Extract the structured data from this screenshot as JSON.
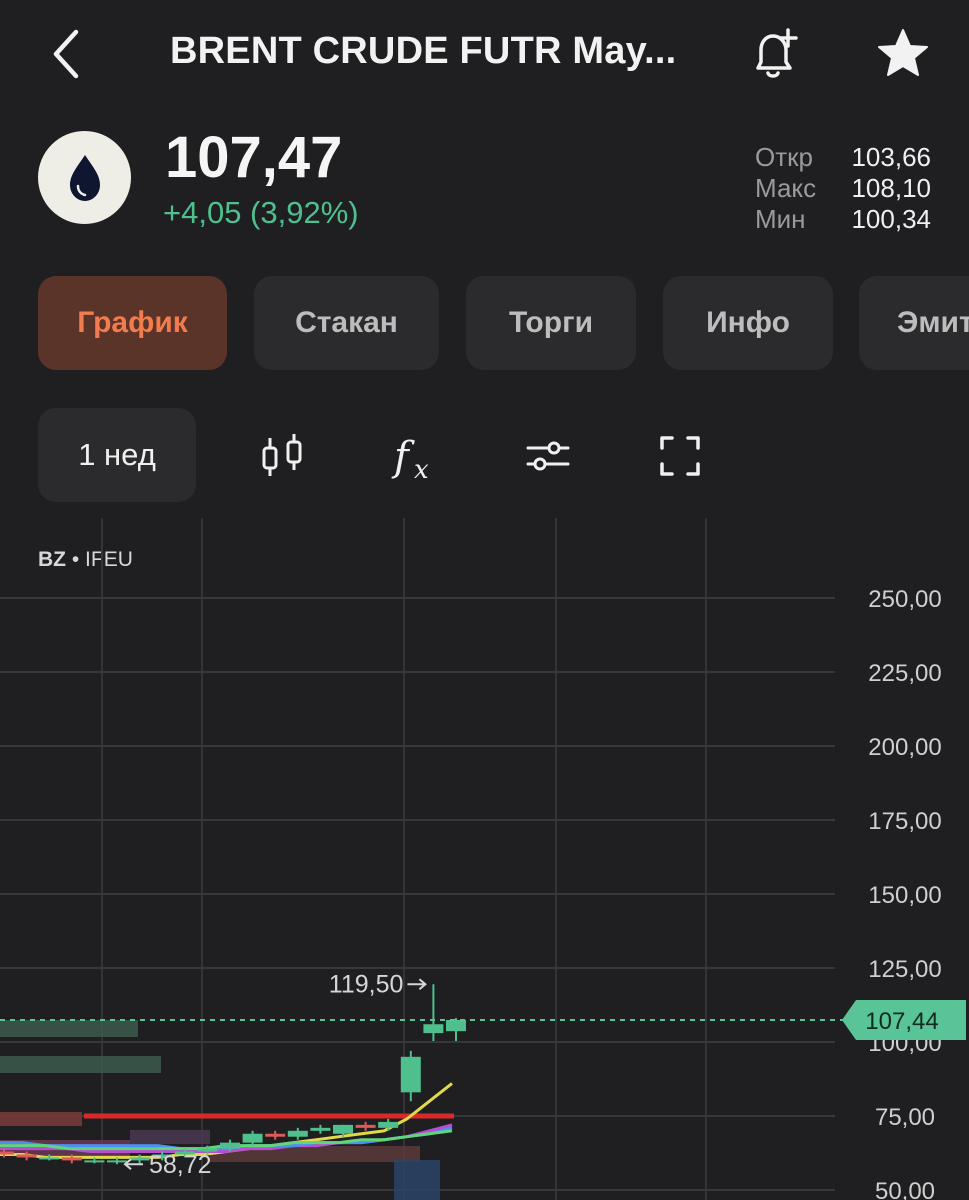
{
  "header": {
    "title": "BRENT CRUDE FUTR  May...",
    "back_icon": "chevron-left-icon",
    "alert_icon": "bell-plus-icon",
    "favorite_icon": "star-icon"
  },
  "instrument": {
    "logo_icon": "oil-drop-icon",
    "price": "107,47",
    "change": "+4,05 (3,92%)",
    "change_color": "#4fc08d",
    "stats": [
      {
        "label": "Откр",
        "value": "103,66"
      },
      {
        "label": "Макс",
        "value": "108,10"
      },
      {
        "label": "Мин",
        "value": "100,34"
      }
    ]
  },
  "tabs": [
    {
      "label": "График",
      "active": true
    },
    {
      "label": "Стакан",
      "active": false
    },
    {
      "label": "Торги",
      "active": false
    },
    {
      "label": "Инфо",
      "active": false
    },
    {
      "label": "Эмитент",
      "active": false
    }
  ],
  "toolbar": {
    "period": "1 нед",
    "tools": [
      "candlestick-icon",
      "function-icon",
      "settings-sliders-icon",
      "fullscreen-icon"
    ]
  },
  "chart_data": {
    "type": "candlestick",
    "ticker": "BZ",
    "exchange": "IFEU",
    "y_ticks": [
      "250,00",
      "225,00",
      "200,00",
      "175,00",
      "150,00",
      "125,00",
      "100,00",
      "75,00",
      "50,00"
    ],
    "ylim": [
      50,
      250
    ],
    "current_price": 107.44,
    "current_price_label": "107,44",
    "max_label": "119,50",
    "min_label": "58,72",
    "accent_current": "#59c596",
    "candles": [
      {
        "o": 63,
        "h": 64,
        "l": 61,
        "c": 62
      },
      {
        "o": 62,
        "h": 63,
        "l": 60,
        "c": 61
      },
      {
        "o": 61,
        "h": 62,
        "l": 60,
        "c": 61
      },
      {
        "o": 61,
        "h": 62,
        "l": 59,
        "c": 60
      },
      {
        "o": 60,
        "h": 61,
        "l": 59,
        "c": 60
      },
      {
        "o": 60,
        "h": 61,
        "l": 58.72,
        "c": 60
      },
      {
        "o": 60,
        "h": 62,
        "l": 59,
        "c": 61
      },
      {
        "o": 61,
        "h": 63,
        "l": 60,
        "c": 62
      },
      {
        "o": 62,
        "h": 64,
        "l": 61,
        "c": 63
      },
      {
        "o": 63,
        "h": 65,
        "l": 62,
        "c": 64
      },
      {
        "o": 64,
        "h": 67,
        "l": 63,
        "c": 66
      },
      {
        "o": 66,
        "h": 70,
        "l": 65,
        "c": 69
      },
      {
        "o": 69,
        "h": 70,
        "l": 67,
        "c": 68
      },
      {
        "o": 68,
        "h": 71,
        "l": 67,
        "c": 70
      },
      {
        "o": 70,
        "h": 72,
        "l": 69,
        "c": 71
      },
      {
        "o": 69,
        "h": 72,
        "l": 68,
        "c": 72
      },
      {
        "o": 72,
        "h": 73,
        "l": 70,
        "c": 71
      },
      {
        "o": 71,
        "h": 74,
        "l": 70,
        "c": 73
      },
      {
        "o": 83,
        "h": 97,
        "l": 80,
        "c": 95
      },
      {
        "o": 103,
        "h": 119.5,
        "l": 100.34,
        "c": 106
      },
      {
        "o": 103.66,
        "h": 108.1,
        "l": 100.34,
        "c": 107.44
      }
    ],
    "ma_lines": [
      {
        "name": "",
        "color": "#e2d94a",
        "values": [
          62,
          62,
          61,
          61,
          61,
          61,
          61,
          61,
          62,
          62,
          63,
          64,
          65,
          66,
          67,
          68,
          69,
          70,
          74,
          80,
          86
        ]
      },
      {
        "name": "",
        "color": "#b84fd1",
        "values": [
          64,
          64,
          64,
          64,
          63,
          63,
          63,
          63,
          63,
          63,
          63,
          64,
          64,
          65,
          65,
          66,
          66,
          67,
          68,
          70,
          72
        ]
      },
      {
        "name": "",
        "color": "#4e8ff0",
        "values": [
          66,
          66,
          65,
          65,
          65,
          65,
          65,
          65,
          64,
          64,
          64,
          65,
          65,
          65,
          66,
          66,
          66,
          67,
          68,
          69,
          71
        ]
      },
      {
        "name": "",
        "color": "#61d57c",
        "values": [
          65,
          65,
          65,
          64,
          64,
          64,
          64,
          64,
          64,
          64,
          65,
          65,
          65,
          66,
          66,
          66,
          67,
          67,
          68,
          69,
          70
        ]
      }
    ]
  }
}
